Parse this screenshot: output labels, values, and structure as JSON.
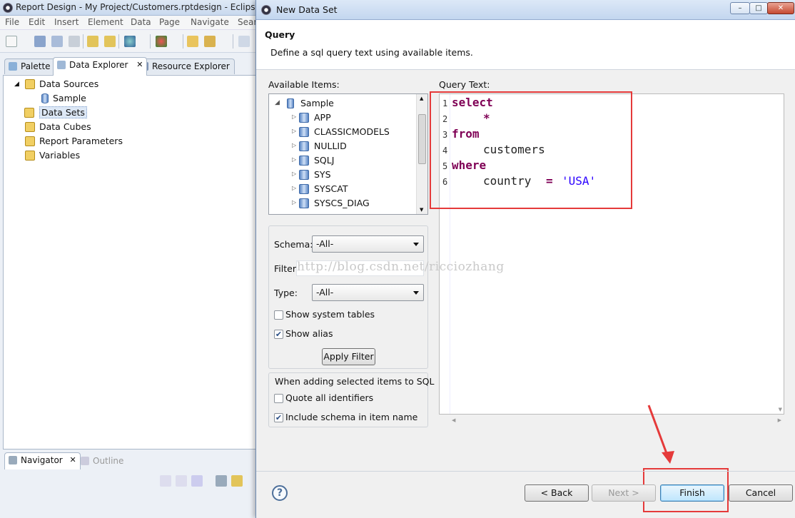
{
  "eclipse": {
    "title": "Report Design - My Project/Customers.rptdesign - Eclipse",
    "menu": [
      "File",
      "Edit",
      "Insert",
      "Element",
      "Data",
      "Page",
      "Navigate",
      "Sear"
    ],
    "tabs": [
      "Palette",
      "Data Explorer",
      "Resource Explorer"
    ],
    "tree": {
      "data_sources": "Data Sources",
      "sample": "Sample",
      "data_sets": "Data Sets",
      "data_cubes": "Data Cubes",
      "report_parameters": "Report Parameters",
      "variables": "Variables"
    },
    "bottom_tabs": [
      "Navigator",
      "Outline"
    ]
  },
  "dialog": {
    "title": "New Data Set",
    "window_buttons": {
      "minimize": "–",
      "maximize": "□",
      "close": "✕"
    },
    "header_title": "Query",
    "header_desc": "Define a sql query text using available items.",
    "available_label": "Available Items:",
    "query_label": "Query Text:",
    "available_items": {
      "root": "Sample",
      "children": [
        "APP",
        "CLASSICMODELS",
        "NULLID",
        "SQLJ",
        "SYS",
        "SYSCAT",
        "SYSCS_DIAG"
      ]
    },
    "filters": {
      "schema_label": "Schema:",
      "schema_value": "-All-",
      "filter_label": "Filter:",
      "filter_value": "",
      "type_label": "Type:",
      "type_value": "-All-",
      "show_system_tables": "Show system tables",
      "show_alias": "Show alias",
      "apply_filter": "Apply Filter"
    },
    "sql_options": {
      "title": "When adding selected items to SQL",
      "quote_all": "Quote all identifiers",
      "include_schema": "Include schema in item name"
    },
    "query": {
      "line_numbers": [
        "1",
        "2",
        "3",
        "4",
        "5",
        "6"
      ],
      "select": "select",
      "star": "*",
      "from": "from",
      "table": "customers",
      "where": "where",
      "column": "country",
      "eq": "=",
      "value": "'USA'"
    },
    "buttons": {
      "help": "?",
      "back": "< Back",
      "next": "Next >",
      "finish": "Finish",
      "cancel": "Cancel"
    },
    "watermark": "http://blog.csdn.net/ricciozhang"
  }
}
